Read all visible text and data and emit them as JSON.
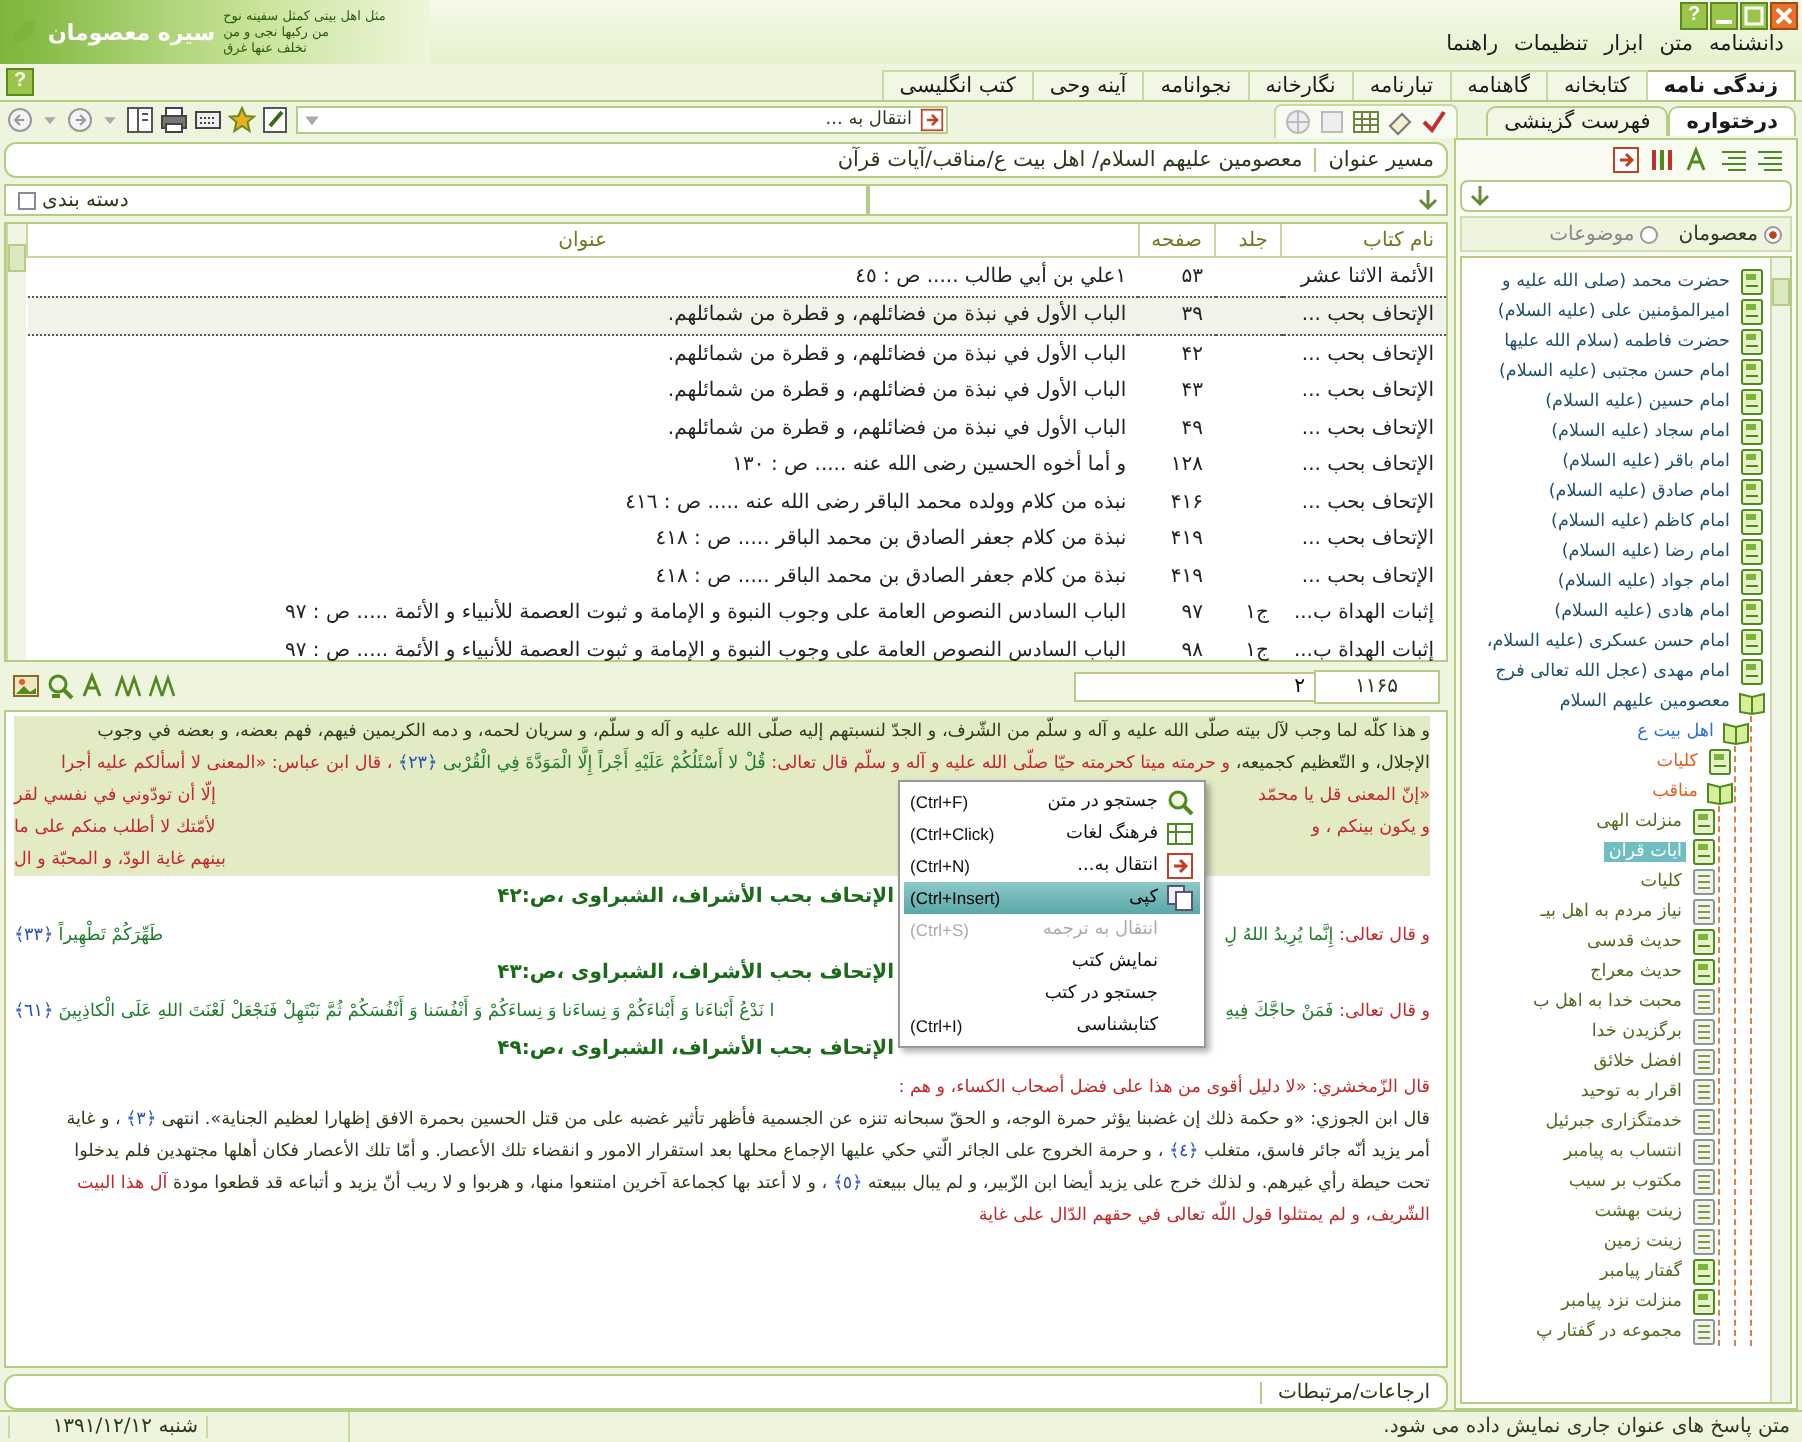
{
  "window": {
    "banner_title": "سیره معصومان",
    "banner_lines": [
      "مثل اهل بیتی کمثل سفینه نوح",
      "من رکبها نجی و من",
      "تخلف عنها غرق"
    ],
    "help_label": "?"
  },
  "menu": [
    "دانشنامه",
    "متن",
    "ابزار",
    "تنظیمات",
    "راهنما"
  ],
  "tabs": [
    {
      "label": "زندگی نامه",
      "selected": true
    },
    {
      "label": "کتابخانه",
      "selected": false
    },
    {
      "label": "گاهنامه",
      "selected": false
    },
    {
      "label": "تبارنامه",
      "selected": false
    },
    {
      "label": "نگارخانه",
      "selected": false
    },
    {
      "label": "نجوانامه",
      "selected": false
    },
    {
      "label": "آینه وحی",
      "selected": false
    },
    {
      "label": "کتب انگلیسی",
      "selected": false
    }
  ],
  "tabs_help": "?",
  "toolbar": {
    "goto_value": "انتقال به ..."
  },
  "side_tabs": [
    {
      "label": "درختواره",
      "selected": true
    },
    {
      "label": "فهرست گزینشی",
      "selected": false
    }
  ],
  "path": {
    "label": "مسیر عنوان",
    "value": "معصومین علیهم السلام/ اهل بیت ع/مناقب/آیات قرآن"
  },
  "filter": {
    "category_label": "دسته بندی",
    "category_checked": false
  },
  "table": {
    "columns": [
      "نام کتاب",
      "جلد",
      "صفحه",
      "عنوان"
    ],
    "rows": [
      {
        "cells": [
          "الأئمة الاثنا عشر",
          "",
          "۵۳",
          "١علي بن أبي طالب ..... ص : ٤٥"
        ],
        "selected": false
      },
      {
        "cells": [
          "الإتحاف بحب ...",
          "",
          "۳۹",
          "الباب الأول في نبذة من فضائلهم، و قطرة من شمائلهم."
        ],
        "selected": true
      },
      {
        "cells": [
          "الإتحاف بحب ...",
          "",
          "۴۲",
          "الباب الأول في نبذة من فضائلهم، و قطرة من شمائلهم."
        ],
        "selected": false
      },
      {
        "cells": [
          "الإتحاف بحب ...",
          "",
          "۴۳",
          "الباب الأول في نبذة من فضائلهم، و قطرة من شمائلهم."
        ],
        "selected": false
      },
      {
        "cells": [
          "الإتحاف بحب ...",
          "",
          "۴۹",
          "الباب الأول في نبذة من فضائلهم، و قطرة من شمائلهم."
        ],
        "selected": false
      },
      {
        "cells": [
          "الإتحاف بحب ...",
          "",
          "۱۲۸",
          "و أما أخوه الحسين رضى الله عنه ..... ص : ١٣٠"
        ],
        "selected": false
      },
      {
        "cells": [
          "الإتحاف بحب ...",
          "",
          "۴۱۶",
          "نبذه من كلام وولده محمد الباقر رضى الله عنه ..... ص : ٤١٦"
        ],
        "selected": false
      },
      {
        "cells": [
          "الإتحاف بحب ...",
          "",
          "۴۱۹",
          "نبذة من كلام جعفر الصادق بن محمد الباقر ..... ص : ٤١٨"
        ],
        "selected": false
      },
      {
        "cells": [
          "الإتحاف بحب ...",
          "",
          "۴۱۹",
          "نبذة من كلام جعفر الصادق بن محمد الباقر ..... ص : ٤١٨"
        ],
        "selected": false
      },
      {
        "cells": [
          "إثبات الهداة ب...",
          "ج۱",
          "۹۷",
          "الباب السادس النصوص العامة على وجوب النبوة و الإمامة و ثبوت العصمة للأنبياء و الأئمة ..... ص : ٩٧"
        ],
        "selected": false
      },
      {
        "cells": [
          "إثبات الهداة ب...",
          "ج۱",
          "۹۸",
          "الباب السادس النصوص العامة على وجوب النبوة و الإمامة و ثبوت العصمة للأنبياء و الأئمة ..... ص : ٩٧"
        ],
        "selected": false
      }
    ]
  },
  "pager": {
    "total": "۱۱۶۵",
    "current": "۲"
  },
  "reader": [
    {
      "kind": "full",
      "highlighted": true,
      "segments": [
        {
          "text": "و هذا كلّه لما وجب لآل بيته صلّى الله عليه و آله و سلّم من الشّرف، و الجدّ لنسبتهم إليه صلّى الله عليه و آله و سلّم، و سريان لحمه، و دمه الكريمين فيهم، فهم بعضه، و بعضه في وجوب",
          "kind": "plain"
        }
      ]
    },
    {
      "kind": "full",
      "highlighted": true,
      "segments": [
        {
          "text": "الإجلال، و التّعظيم كجميعه،",
          "kind": "plain"
        },
        {
          "text": "و حرمته ميتا كحرمته حيّا صلّى الله عليه و آله و سلّم قال تعالى:",
          "kind": "red"
        },
        {
          "text": "قُلْ لا أَسْئَلُكُمْ عَلَيْهِ أَجْراً إِلَّا الْمَوَدَّةَ فِي الْقُرْبى",
          "kind": "quran"
        },
        {
          "text": "﴿٢٣﴾",
          "kind": "ref"
        },
        {
          "text": "، قال ابن عباس: «المعنى لا أسألكم عليه أجرا",
          "kind": "red"
        }
      ]
    },
    {
      "kind": "split",
      "highlighted": true,
      "left": [
        {
          "text": "إلّا أن تودّوني في نفسي لقر",
          "kind": "red"
        }
      ],
      "right": [
        {
          "text": "«إنّ المعنى قل يا محمّد",
          "kind": "red"
        }
      ]
    },
    {
      "kind": "split",
      "highlighted": true,
      "left": [
        {
          "text": "لأمّتك لا أطلب منكم على ما",
          "kind": "red"
        }
      ],
      "right": [
        {
          "text": "و يكون بينكم ، و",
          "kind": "red"
        }
      ]
    },
    {
      "kind": "split",
      "highlighted": true,
      "left": [
        {
          "text": "بينهم غاية الودّ، و المحبّة و ال",
          "kind": "red"
        }
      ]
    },
    {
      "kind": "heading",
      "text": "الإتحاف بحب الأشراف، الشبراوی ،ص:۴۲"
    },
    {
      "kind": "split",
      "highlighted": false,
      "left": [
        {
          "text": "طَهِّرَكُمْ تَطْهِيراً",
          "kind": "quran"
        },
        {
          "text": "﴿٣٣﴾",
          "kind": "ref"
        }
      ],
      "right": [
        {
          "text": "و قال تعالى:",
          "kind": "red"
        },
        {
          "text": "إِنَّما يُرِيدُ اللهُ لِ",
          "kind": "quran"
        }
      ]
    },
    {
      "kind": "heading",
      "text": "الإتحاف بحب الأشراف، الشبراوی ،ص:۴۳"
    },
    {
      "kind": "split",
      "highlighted": false,
      "left": [
        {
          "text": "ا نَدْعُ أَبْناءَنا وَ أَبْناءَكُمْ وَ نِساءَنا وَ نِساءَكُمْ وَ أَنْفُسَنا وَ أَنْفُسَكُمْ ثُمَّ نَبْتَهِلْ فَنَجْعَلْ لَعْنَتَ اللهِ عَلَى الْكاذِبِينَ",
          "kind": "quran"
        },
        {
          "text": "﴿٦١﴾",
          "kind": "ref"
        }
      ],
      "right": [
        {
          "text": "و قال تعالى:",
          "kind": "red"
        },
        {
          "text": "فَمَنْ حاجَّكَ فِيهِ",
          "kind": "quran"
        }
      ]
    },
    {
      "kind": "heading",
      "text": "الإتحاف بحب الأشراف، الشبراوی ،ص:۴۹"
    },
    {
      "kind": "full",
      "highlighted": false,
      "segments": [
        {
          "text": "قال الزّمخشري: «لا دليل أقوى من هذا على فضل أصحاب الكساء، و هم :",
          "kind": "red"
        }
      ]
    },
    {
      "kind": "full",
      "highlighted": false,
      "segments": [
        {
          "text": "قال ابن الجوزي: «و حكمة ذلك إن غضبنا يؤثر حمرة الوجه، و الحقّ سبحانه تنزه عن الجسمية فأظهر تأثير غضبه على من قتل الحسين بحمرة الافق إظهارا لعظيم الجناية». انتهى",
          "kind": "plain"
        },
        {
          "text": "﴿٣﴾",
          "kind": "ref"
        },
        {
          "text": "، و غاية",
          "kind": "plain"
        }
      ]
    },
    {
      "kind": "full",
      "highlighted": false,
      "segments": [
        {
          "text": "أمر يزيد أنّه جائر فاسق، متغلب",
          "kind": "plain"
        },
        {
          "text": "﴿٤﴾",
          "kind": "ref"
        },
        {
          "text": "، و حرمة الخروج على الجائر الّتي حكي عليها الإجماع محلها بعد استقرار الامور و انقضاء تلك الأعصار. و أمّا تلك الأعصار فكان أهلها مجتهدين فلم يدخلوا",
          "kind": "plain"
        }
      ]
    },
    {
      "kind": "full",
      "highlighted": false,
      "segments": [
        {
          "text": "تحت حيطة رأي غيرهم. و لذلك خرج على يزيد أيضا ابن الزّبير، و لم يبال ببيعته",
          "kind": "plain"
        },
        {
          "text": "﴿٥﴾",
          "kind": "ref"
        },
        {
          "text": "، و لا أعتد بها كجماعة آخرين امتنعوا منها، و هربوا و لا ريب أنّ يزيد و أتباعه قد قطعوا مودة",
          "kind": "plain"
        },
        {
          "text": "آل هذا البيت",
          "kind": "red"
        }
      ]
    },
    {
      "kind": "full",
      "highlighted": false,
      "segments": [
        {
          "text": "الشّريف، و لم يمتثلوا قول اللّه تعالى في حقهم الدّال على غاية",
          "kind": "red"
        }
      ]
    }
  ],
  "context_menu": [
    {
      "label": "جستجو در متن",
      "shortcut": "(Ctrl+F)",
      "kind": "search",
      "selected": false,
      "disabled": false
    },
    {
      "label": "فرهنگ لغات",
      "shortcut": "(Ctrl+Click)",
      "kind": "dictionary",
      "selected": false,
      "disabled": false
    },
    {
      "label": "انتقال به...",
      "shortcut": "(Ctrl+N)",
      "kind": "goto",
      "selected": false,
      "disabled": false
    },
    {
      "label": "کپی",
      "shortcut": "(Ctrl+Insert)",
      "kind": "copy",
      "selected": true,
      "disabled": false
    },
    {
      "label": "انتقال به ترجمه",
      "shortcut": "(Ctrl+S)",
      "kind": "plain",
      "selected": false,
      "disabled": true
    },
    {
      "label": "نمایش کتب",
      "kind": "plain",
      "selected": false,
      "disabled": false
    },
    {
      "label": "جستجو در کتب",
      "kind": "plain",
      "selected": false,
      "disabled": false
    },
    {
      "label": "کتابشناسی",
      "shortcut": "(Ctrl+I)",
      "kind": "plain",
      "selected": false,
      "disabled": false
    }
  ],
  "references": {
    "label": "ارجاعات/مرتبطات"
  },
  "status": {
    "date": "شنبه ۱۳۹۱/۱۲/۱۲",
    "message": "متن پاسخ های عنوان جاری نمایش داده می شود."
  },
  "sidebar": {
    "radios": [
      {
        "label": "معصومان",
        "selected": true
      },
      {
        "label": "موضوعات",
        "selected": false
      }
    ],
    "tree": [
      {
        "label": "حضرت محمد (صلی الله علیه و",
        "kind": "book",
        "selected": false
      },
      {
        "label": "امیرالمؤمنین علی (علیه السلام)",
        "kind": "book",
        "selected": false
      },
      {
        "label": "حضرت فاطمه (سلام الله علیها",
        "kind": "book",
        "selected": false
      },
      {
        "label": "امام حسن مجتبی (علیه السلام)",
        "kind": "book",
        "selected": false
      },
      {
        "label": "امام حسین (علیه السلام)",
        "kind": "book",
        "selected": false
      },
      {
        "label": "امام سجاد (علیه السلام)",
        "kind": "book",
        "selected": false
      },
      {
        "label": "امام باقر (علیه السلام)",
        "kind": "book",
        "selected": false
      },
      {
        "label": "امام صادق (علیه السلام)",
        "kind": "book",
        "selected": false
      },
      {
        "label": "امام کاظم (علیه السلام)",
        "kind": "book",
        "selected": false
      },
      {
        "label": "امام رضا (علیه السلام)",
        "kind": "book",
        "selected": false
      },
      {
        "label": "امام جواد (علیه السلام)",
        "kind": "book",
        "selected": false
      },
      {
        "label": "امام هادی (علیه السلام)",
        "kind": "book",
        "selected": false
      },
      {
        "label": "امام حسن عسکری (علیه السلام،",
        "kind": "book",
        "selected": false
      },
      {
        "label": "امام مهدی (عجل الله تعالی فرج",
        "kind": "book",
        "selected": false
      },
      {
        "label": "معصومین علیهم السلام",
        "kind": "open",
        "selected": false,
        "children": [
          {
            "label": "اهل بیت ع",
            "kind": "open",
            "selected": false,
            "children": [
              {
                "label": "کلیات",
                "kind": "book",
                "selected": false
              },
              {
                "label": "مناقب",
                "kind": "open",
                "selected": false,
                "children": [
                  {
                    "label": "منزلت الهی",
                    "kind": "book",
                    "selected": false
                  },
                  {
                    "label": "آیات قرآن",
                    "kind": "book",
                    "selected": true
                  },
                  {
                    "label": "کلیات",
                    "kind": "page",
                    "selected": false
                  },
                  {
                    "label": "نیاز مردم به اهل بیـ",
                    "kind": "page",
                    "selected": false
                  },
                  {
                    "label": "حدیث قدسی",
                    "kind": "book",
                    "selected": false
                  },
                  {
                    "label": "حدیث معراج",
                    "kind": "book",
                    "selected": false
                  },
                  {
                    "label": "محبت خدا به اهل ب",
                    "kind": "page",
                    "selected": false
                  },
                  {
                    "label": "برگزیدن خدا",
                    "kind": "page",
                    "selected": false
                  },
                  {
                    "label": "افضل خلائق",
                    "kind": "page",
                    "selected": false
                  },
                  {
                    "label": "اقرار به توحید",
                    "kind": "page",
                    "selected": false
                  },
                  {
                    "label": "خدمتگزاری جبرئیل",
                    "kind": "page",
                    "selected": false
                  },
                  {
                    "label": "انتساب به پیامبر",
                    "kind": "page",
                    "selected": false
                  },
                  {
                    "label": "مکتوب بر سیب",
                    "kind": "page",
                    "selected": false
                  },
                  {
                    "label": "زینت بهشت",
                    "kind": "page",
                    "selected": false
                  },
                  {
                    "label": "زینت زمین",
                    "kind": "page",
                    "selected": false
                  },
                  {
                    "label": "گفتار پیامبر",
                    "kind": "book",
                    "selected": false
                  },
                  {
                    "label": "منزلت نزد پیامبر",
                    "kind": "book",
                    "selected": false
                  },
                  {
                    "label": "مجموعه در گفتار پ",
                    "kind": "page",
                    "selected": false
                  }
                ]
              }
            ]
          }
        ]
      }
    ]
  }
}
